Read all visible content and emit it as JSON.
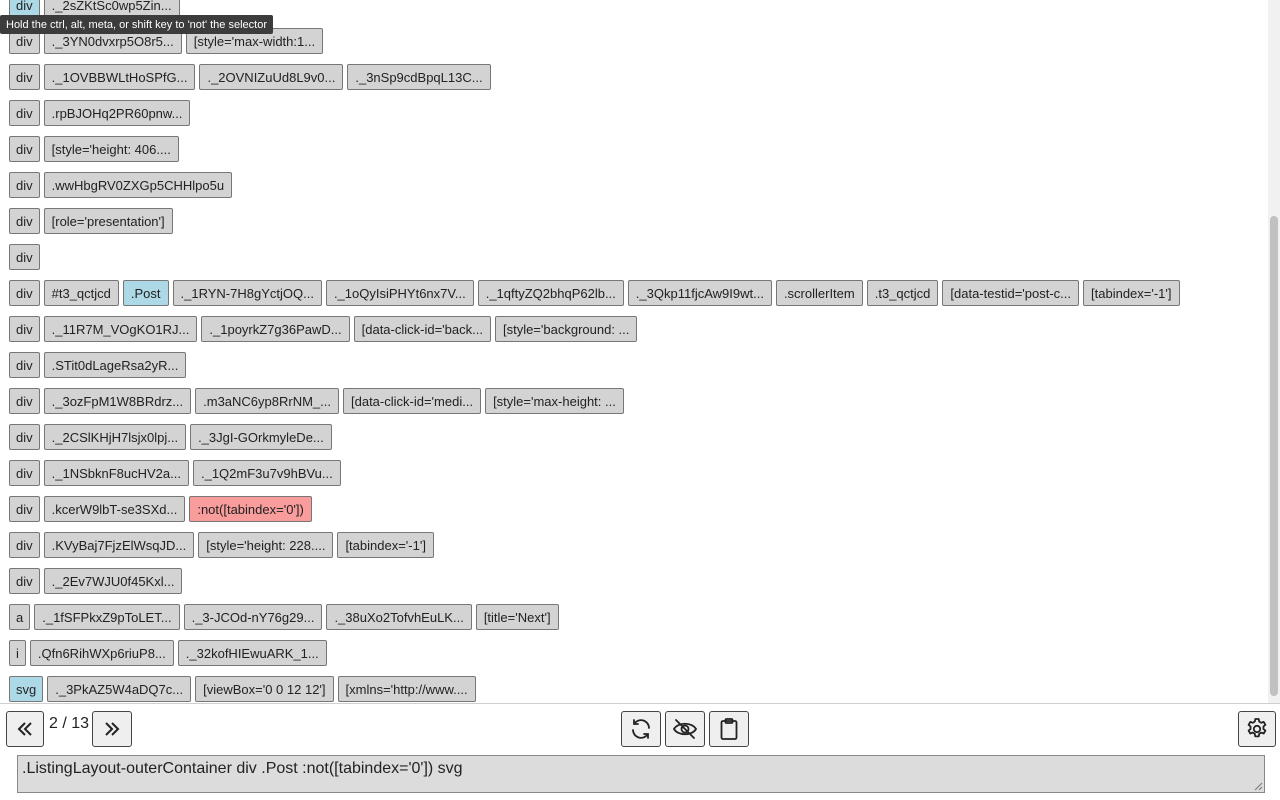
{
  "tooltip": "Hold the ctrl, alt, meta, or shift key to 'not' the selector",
  "rows": [
    [
      {
        "t": "div",
        "k": "tag",
        "s": "sel"
      },
      {
        "t": "._2sZKtSc0wp5Zin...",
        "k": "chip"
      }
    ],
    [
      {
        "t": "div",
        "k": "tag"
      },
      {
        "t": "._3YN0dvxrp5O8r5...",
        "k": "chip"
      },
      {
        "t": "[style='max-width:1...",
        "k": "chip"
      }
    ],
    [
      {
        "t": "div",
        "k": "tag"
      },
      {
        "t": "._1OVBBWLtHoSPfG...",
        "k": "chip"
      },
      {
        "t": "._2OVNIZuUd8L9v0...",
        "k": "chip"
      },
      {
        "t": "._3nSp9cdBpqL13C...",
        "k": "chip"
      }
    ],
    [
      {
        "t": "div",
        "k": "tag"
      },
      {
        "t": ".rpBJOHq2PR60pnw...",
        "k": "chip"
      }
    ],
    [
      {
        "t": "div",
        "k": "tag"
      },
      {
        "t": "[style='height: 406....",
        "k": "chip"
      }
    ],
    [
      {
        "t": "div",
        "k": "tag"
      },
      {
        "t": ".wwHbgRV0ZXGp5CHHlpo5u",
        "k": "chip"
      }
    ],
    [
      {
        "t": "div",
        "k": "tag"
      },
      {
        "t": "[role='presentation']",
        "k": "chip"
      }
    ],
    [
      {
        "t": "div",
        "k": "tag"
      }
    ],
    [
      {
        "t": "div",
        "k": "tag"
      },
      {
        "t": "#t3_qctjcd",
        "k": "chip"
      },
      {
        "t": ".Post",
        "k": "chip",
        "s": "sel"
      },
      {
        "t": "._1RYN-7H8gYctjOQ...",
        "k": "chip"
      },
      {
        "t": "._1oQyIsiPHYt6nx7V...",
        "k": "chip"
      },
      {
        "t": "._1qftyZQ2bhqP62lb...",
        "k": "chip"
      },
      {
        "t": "._3Qkp11fjcAw9I9wt...",
        "k": "chip"
      },
      {
        "t": ".scrollerItem",
        "k": "chip"
      },
      {
        "t": ".t3_qctjcd",
        "k": "chip"
      },
      {
        "t": "[data-testid='post-c...",
        "k": "chip"
      },
      {
        "t": "[tabindex='-1']",
        "k": "chip"
      }
    ],
    [
      {
        "t": "div",
        "k": "tag"
      },
      {
        "t": "._11R7M_VOgKO1RJ...",
        "k": "chip"
      },
      {
        "t": "._1poyrkZ7g36PawD...",
        "k": "chip"
      },
      {
        "t": "[data-click-id='back...",
        "k": "chip"
      },
      {
        "t": "[style='background: ...",
        "k": "chip"
      }
    ],
    [
      {
        "t": "div",
        "k": "tag"
      },
      {
        "t": ".STit0dLageRsa2yR...",
        "k": "chip"
      }
    ],
    [
      {
        "t": "div",
        "k": "tag"
      },
      {
        "t": "._3ozFpM1W8BRdrz...",
        "k": "chip"
      },
      {
        "t": ".m3aNC6yp8RrNM_...",
        "k": "chip"
      },
      {
        "t": "[data-click-id='medi...",
        "k": "chip"
      },
      {
        "t": "[style='max-height: ...",
        "k": "chip"
      }
    ],
    [
      {
        "t": "div",
        "k": "tag"
      },
      {
        "t": "._2CSlKHjH7lsjx0lpj...",
        "k": "chip"
      },
      {
        "t": "._3JgI-GOrkmyleDe...",
        "k": "chip"
      }
    ],
    [
      {
        "t": "div",
        "k": "tag"
      },
      {
        "t": "._1NSbknF8ucHV2a...",
        "k": "chip"
      },
      {
        "t": "._1Q2mF3u7v9hBVu...",
        "k": "chip"
      }
    ],
    [
      {
        "t": "div",
        "k": "tag"
      },
      {
        "t": ".kcerW9lbT-se3SXd...",
        "k": "chip"
      },
      {
        "t": ":not([tabindex='0'])",
        "k": "chip",
        "s": "neg"
      }
    ],
    [
      {
        "t": "div",
        "k": "tag"
      },
      {
        "t": ".KVyBaj7FjzElWsqJD...",
        "k": "chip"
      },
      {
        "t": "[style='height: 228....",
        "k": "chip"
      },
      {
        "t": "[tabindex='-1']",
        "k": "chip"
      }
    ],
    [
      {
        "t": "div",
        "k": "tag"
      },
      {
        "t": "._2Ev7WJU0f45Kxl...",
        "k": "chip"
      }
    ],
    [
      {
        "t": "a",
        "k": "tag"
      },
      {
        "t": "._1fSFPkxZ9pToLET...",
        "k": "chip"
      },
      {
        "t": "._3-JCOd-nY76g29...",
        "k": "chip"
      },
      {
        "t": "._38uXo2TofvhEuLK...",
        "k": "chip"
      },
      {
        "t": "[title='Next']",
        "k": "chip"
      }
    ],
    [
      {
        "t": "i",
        "k": "tag"
      },
      {
        "t": ".Qfn6RihWXp6riuP8...",
        "k": "chip"
      },
      {
        "t": "._32kofHIEwuARK_1...",
        "k": "chip"
      }
    ],
    [
      {
        "t": "svg",
        "k": "tag",
        "s": "sel"
      },
      {
        "t": "._3PkAZ5W4aDQ7c...",
        "k": "chip"
      },
      {
        "t": "[viewBox='0 0 12 12']",
        "k": "chip"
      },
      {
        "t": "[xmlns='http://www....",
        "k": "chip"
      }
    ]
  ],
  "pager": {
    "current": "2",
    "separator": "/",
    "total": "13"
  },
  "icons": {
    "prev": "double-chevron-left-icon",
    "next": "double-chevron-right-icon",
    "refresh": "refresh-icon",
    "hide": "eye-slash-icon",
    "copy": "clipboard-icon",
    "settings": "gear-icon"
  },
  "colors": {
    "selected": "#add8e6",
    "negated": "#f89c9c",
    "chip": "#d3d3d3"
  },
  "selector_text": ".ListingLayout-outerContainer div .Post :not([tabindex='0']) svg"
}
